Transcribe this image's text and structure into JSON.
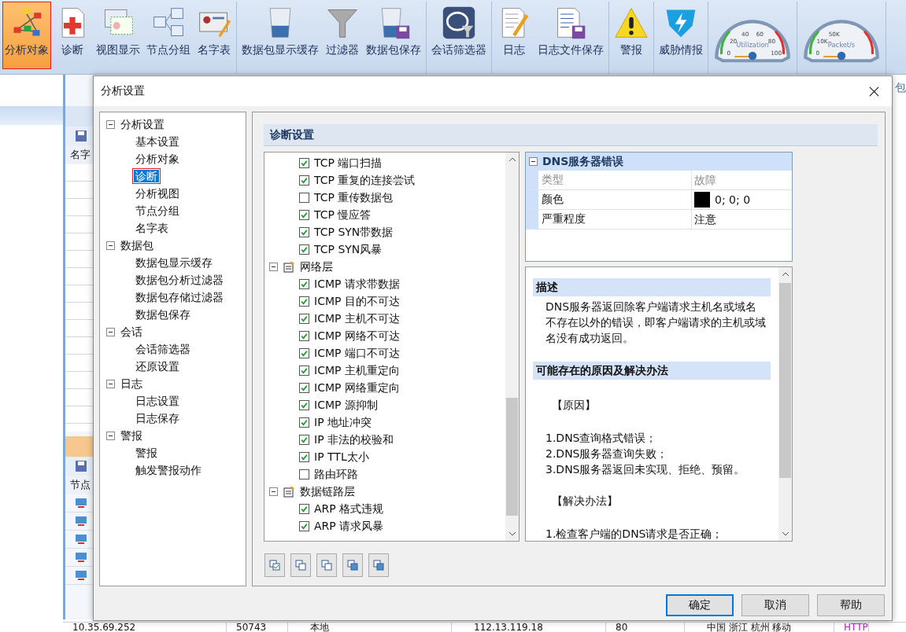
{
  "toolbar": {
    "groups": [
      {
        "buttons": [
          {
            "label": "分析对象",
            "selected": true
          },
          {
            "label": "诊断",
            "selected": false
          },
          {
            "label": "视图显示",
            "selected": false
          },
          {
            "label": "节点分组",
            "selected": false
          },
          {
            "label": "名字表",
            "selected": false
          }
        ]
      },
      {
        "buttons": [
          {
            "label": "数据包显示缓存",
            "selected": false
          },
          {
            "label": "过滤器",
            "selected": false
          },
          {
            "label": "数据包保存",
            "selected": false
          }
        ]
      },
      {
        "buttons": [
          {
            "label": "会话筛选器",
            "selected": false
          }
        ]
      },
      {
        "buttons": [
          {
            "label": "日志",
            "selected": false
          },
          {
            "label": "日志文件保存",
            "selected": false
          }
        ]
      },
      {
        "buttons": [
          {
            "label": "警报",
            "selected": false
          }
        ]
      },
      {
        "buttons": [
          {
            "label": "威胁情报",
            "selected": false
          }
        ]
      }
    ],
    "gauges": [
      {
        "caption": "Utilization",
        "scale": [
          "0",
          "20",
          "40",
          "60",
          "80",
          "100"
        ]
      },
      {
        "caption": "Packet/s",
        "scale": [
          "0",
          "10K",
          "50K"
        ]
      }
    ]
  },
  "background": {
    "grid_header": "名字",
    "lower_header": "节点",
    "right_peek": "包",
    "bottom_row": [
      "10.35.69.252",
      "50743",
      "本地",
      "112.13.119.18",
      "80",
      "中国 浙江 杭州 移动",
      "HTTP"
    ]
  },
  "dialog": {
    "title": "分析设置",
    "tree": [
      {
        "label": "分析设置",
        "expanded": true,
        "children": [
          {
            "label": "基本设置",
            "selected": false
          },
          {
            "label": "分析对象",
            "selected": false
          },
          {
            "label": "诊断",
            "selected": true
          },
          {
            "label": "分析视图",
            "selected": false
          },
          {
            "label": "节点分组",
            "selected": false
          },
          {
            "label": "名字表",
            "selected": false
          }
        ]
      },
      {
        "label": "数据包",
        "expanded": true,
        "children": [
          {
            "label": "数据包显示缓存",
            "selected": false
          },
          {
            "label": "数据包分析过滤器",
            "selected": false
          },
          {
            "label": "数据包存储过滤器",
            "selected": false
          },
          {
            "label": "数据包保存",
            "selected": false
          }
        ]
      },
      {
        "label": "会话",
        "expanded": true,
        "children": [
          {
            "label": "会话筛选器",
            "selected": false
          },
          {
            "label": "还原设置",
            "selected": false
          }
        ]
      },
      {
        "label": "日志",
        "expanded": true,
        "children": [
          {
            "label": "日志设置",
            "selected": false
          },
          {
            "label": "日志保存",
            "selected": false
          }
        ]
      },
      {
        "label": "警报",
        "expanded": true,
        "children": [
          {
            "label": "警报",
            "selected": false
          },
          {
            "label": "触发警报动作",
            "selected": false
          }
        ]
      }
    ],
    "section_title": "诊断设置",
    "checklist": [
      {
        "children": [
          {
            "label": "TCP 端口扫描",
            "checked": true
          },
          {
            "label": "TCP 重复的连接尝试",
            "checked": true
          },
          {
            "label": "TCP 重传数据包",
            "checked": false
          },
          {
            "label": "TCP 慢应答",
            "checked": true
          },
          {
            "label": "TCP SYN带数据",
            "checked": true
          },
          {
            "label": "TCP SYN风暴",
            "checked": true
          }
        ]
      },
      {
        "label": "网络层",
        "expanded": true,
        "children": [
          {
            "label": "ICMP 请求带数据",
            "checked": true
          },
          {
            "label": "ICMP 目的不可达",
            "checked": true
          },
          {
            "label": "ICMP 主机不可达",
            "checked": true
          },
          {
            "label": "ICMP 网络不可达",
            "checked": true
          },
          {
            "label": "ICMP 端口不可达",
            "checked": true
          },
          {
            "label": "ICMP 主机重定向",
            "checked": true
          },
          {
            "label": "ICMP 网络重定向",
            "checked": true
          },
          {
            "label": "ICMP 源抑制",
            "checked": true
          },
          {
            "label": "IP 地址冲突",
            "checked": true
          },
          {
            "label": "IP 非法的校验和",
            "checked": true
          },
          {
            "label": "IP TTL太小",
            "checked": true
          },
          {
            "label": "路由环路",
            "checked": false
          }
        ]
      },
      {
        "label": "数据链路层",
        "expanded": true,
        "children": [
          {
            "label": "ARP 格式违规",
            "checked": true
          },
          {
            "label": "ARP 请求风暴",
            "checked": true
          }
        ]
      }
    ],
    "properties": {
      "title": "DNS服务器错误",
      "expanded": true,
      "rows": [
        {
          "kind": "readonly",
          "name": "类型",
          "value": "故障"
        },
        {
          "kind": "color",
          "name": "颜色",
          "value": "0; 0; 0",
          "color": "#000000"
        },
        {
          "kind": "text",
          "name": "严重程度",
          "value": "注意"
        }
      ]
    },
    "description": [
      {
        "heading": "描述",
        "blocks": [
          {
            "kind": "paragraph",
            "lines": [
              "DNS服务器返回除客户端请求主机名或域名不存在以外的错误，即客户端请求的主机或域名没有成功返回。"
            ]
          }
        ]
      },
      {
        "heading": "可能存在的原因及解决办法",
        "blocks": [
          {
            "kind": "label",
            "lines": [
              "【原因】"
            ]
          },
          {
            "kind": "list",
            "lines": [
              "1.DNS查询格式错误；",
              "2.DNS服务器查询失败；",
              "3.DNS服务器返回未实现、拒绝、预留。"
            ]
          },
          {
            "kind": "label",
            "lines": [
              "【解决办法】"
            ]
          },
          {
            "kind": "list",
            "lines": [
              "1.检查客户端的DNS请求是否正确；"
            ]
          }
        ]
      }
    ],
    "buttons": [
      {
        "label": "确定",
        "default": true
      },
      {
        "label": "取消",
        "default": false
      },
      {
        "label": "帮助",
        "default": false
      }
    ]
  }
}
